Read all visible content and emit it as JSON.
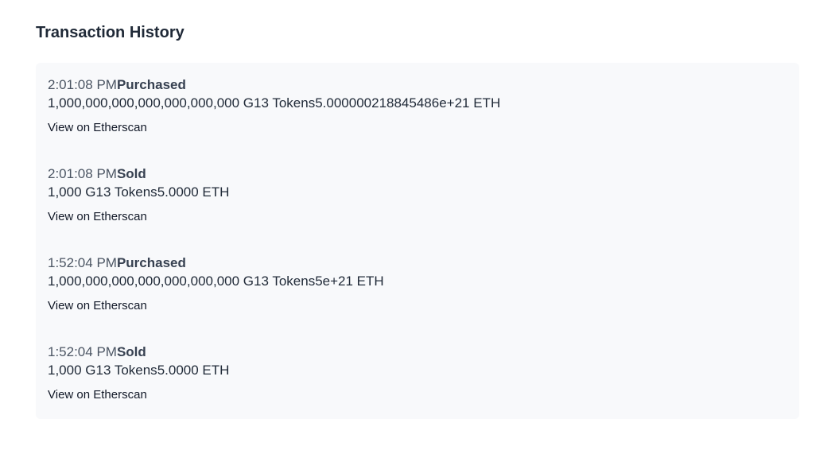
{
  "section": {
    "title": "Transaction History"
  },
  "transactions": [
    {
      "time": "2:01:08 PM",
      "type": "Purchased",
      "tokens": "1,000,000,000,000,000,000,000 G13 Tokens",
      "eth": "5.000000218845486e+21 ETH",
      "link_label": "View on Etherscan"
    },
    {
      "time": "2:01:08 PM",
      "type": "Sold",
      "tokens": "1,000 G13 Tokens",
      "eth": "5.0000 ETH",
      "link_label": "View on Etherscan"
    },
    {
      "time": "1:52:04 PM",
      "type": "Purchased",
      "tokens": "1,000,000,000,000,000,000,000 G13 Tokens",
      "eth": "5e+21 ETH",
      "link_label": "View on Etherscan"
    },
    {
      "time": "1:52:04 PM",
      "type": "Sold",
      "tokens": "1,000 G13 Tokens",
      "eth": "5.0000 ETH",
      "link_label": "View on Etherscan"
    }
  ]
}
